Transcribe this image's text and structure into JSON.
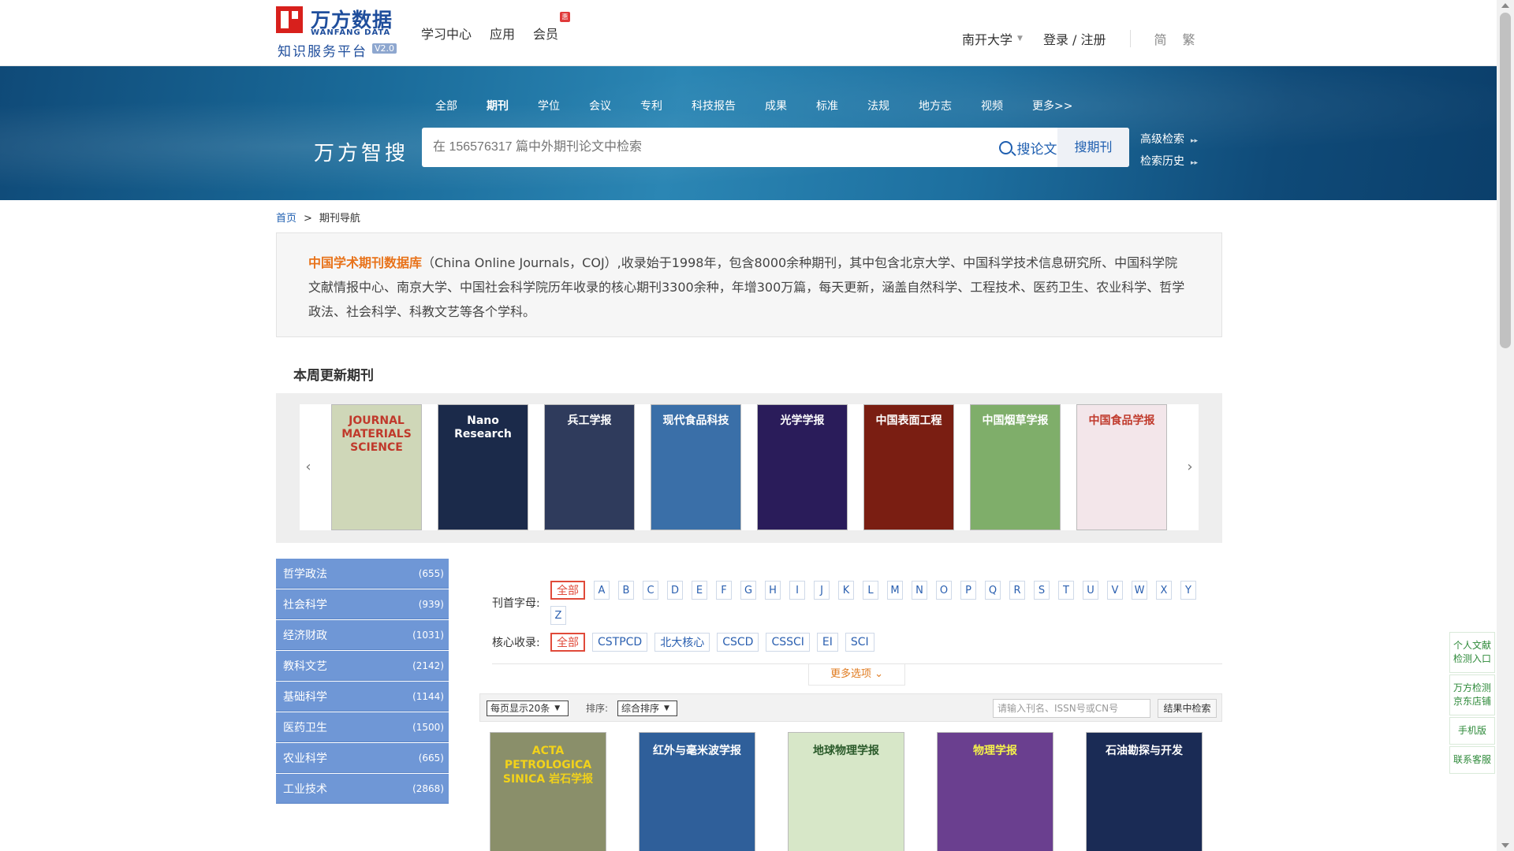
{
  "header": {
    "logo_cn": "万方数据",
    "logo_en": "WANFANG DATA",
    "logo_sub": "知识服务平台",
    "logo_version": "V2.0",
    "nav": [
      "学习中心",
      "应用",
      "会员"
    ],
    "member_badge": "惠",
    "institution": "南开大学",
    "login": "登录 / 注册",
    "lang_simplified": "简",
    "lang_traditional": "繁"
  },
  "search": {
    "tabs": [
      "全部",
      "期刊",
      "学位",
      "会议",
      "专利",
      "科技报告",
      "成果",
      "标准",
      "法规",
      "地方志",
      "视频",
      "更多>>"
    ],
    "active_tab": "期刊",
    "brand": "万方智搜",
    "placeholder": "在 156576317 篇中外期刊论文中检索",
    "search_paper": "搜论文",
    "search_journal": "搜期刊",
    "advanced": "高级检索",
    "history": "检索历史"
  },
  "breadcrumb": {
    "home": "首页",
    "sep": ">",
    "current": "期刊导航"
  },
  "intro": {
    "name": "中国学术期刊数据库",
    "text": "（China Online Journals，COJ）,收录始于1998年，包含8000余种期刊，其中包含北京大学、中国科学技术信息研究所、中国科学院文献情报中心、南京大学、中国社会科学院历年收录的核心期刊3300余种，年增300万篇，每天更新，涵盖自然科学、工程技术、医药卫生、农业科学、哲学政法、社会科学、科教文艺等各个学科。"
  },
  "weekly": {
    "title": "本周更新期刊",
    "prev": "‹",
    "next": "›",
    "covers": [
      {
        "title": "JOURNAL MATERIALS SCIENCE",
        "bg": "#cfd7b8",
        "fg": "#c0392b"
      },
      {
        "title": "Nano Research",
        "bg": "#1b2a4a",
        "fg": "#ffffff"
      },
      {
        "title": "兵工学报",
        "bg": "#2f3b5c",
        "fg": "#ffffff"
      },
      {
        "title": "现代食品科技",
        "bg": "#3a6fa8",
        "fg": "#ffffff"
      },
      {
        "title": "光学学报",
        "bg": "#2a1c5a",
        "fg": "#ffffff"
      },
      {
        "title": "中国表面工程",
        "bg": "#7a1e12",
        "fg": "#ffffff"
      },
      {
        "title": "中国烟草学报",
        "bg": "#7fae6a",
        "fg": "#ffffff"
      },
      {
        "title": "中国食品学报",
        "bg": "#f3e6ea",
        "fg": "#c0392b"
      }
    ]
  },
  "sidebar": [
    {
      "label": "哲学政法",
      "count": "(655)"
    },
    {
      "label": "社会科学",
      "count": "(939)"
    },
    {
      "label": "经济财政",
      "count": "(1031)"
    },
    {
      "label": "教科文艺",
      "count": "(2142)"
    },
    {
      "label": "基础科学",
      "count": "(1144)"
    },
    {
      "label": "医药卫生",
      "count": "(1500)"
    },
    {
      "label": "农业科学",
      "count": "(665)"
    },
    {
      "label": "工业技术",
      "count": "(2868)"
    }
  ],
  "filters": {
    "initial_label": "刊首字母:",
    "all": "全部",
    "letters": [
      "A",
      "B",
      "C",
      "D",
      "E",
      "F",
      "G",
      "H",
      "I",
      "J",
      "K",
      "L",
      "M",
      "N",
      "O",
      "P",
      "Q",
      "R",
      "S",
      "T",
      "U",
      "V",
      "W",
      "X",
      "Y",
      "Z"
    ],
    "core_label": "核心收录:",
    "core": [
      "全部",
      "CSTPCD",
      "北大核心",
      "CSCD",
      "CSSCI",
      "EI",
      "SCI"
    ],
    "more": "更多选项"
  },
  "toolbar": {
    "per_page": "每页显示20条",
    "sort_label": "排序:",
    "sort_value": "综合排序",
    "inner_placeholder": "请输入刊名、ISSN号或CN号",
    "inner_button": "结果中检索"
  },
  "results": [
    {
      "title": "ACTA PETROLOGICA SINICA 岩石学报",
      "bg": "#8a8f6a",
      "fg": "#f2d21a"
    },
    {
      "title": "红外与毫米波学报",
      "bg": "#2f5f9a",
      "fg": "#ffffff"
    },
    {
      "title": "地球物理学报",
      "bg": "#d7e7c8",
      "fg": "#2a5a2a"
    },
    {
      "title": "物理学报",
      "bg": "#6a3f8f",
      "fg": "#f5f24a"
    },
    {
      "title": "石油勘探与开发",
      "bg": "#1a2b55",
      "fg": "#ffffff"
    }
  ],
  "float": [
    "个人文献检测入口",
    "万方检测京东店铺",
    "手机版",
    "联系客服"
  ]
}
